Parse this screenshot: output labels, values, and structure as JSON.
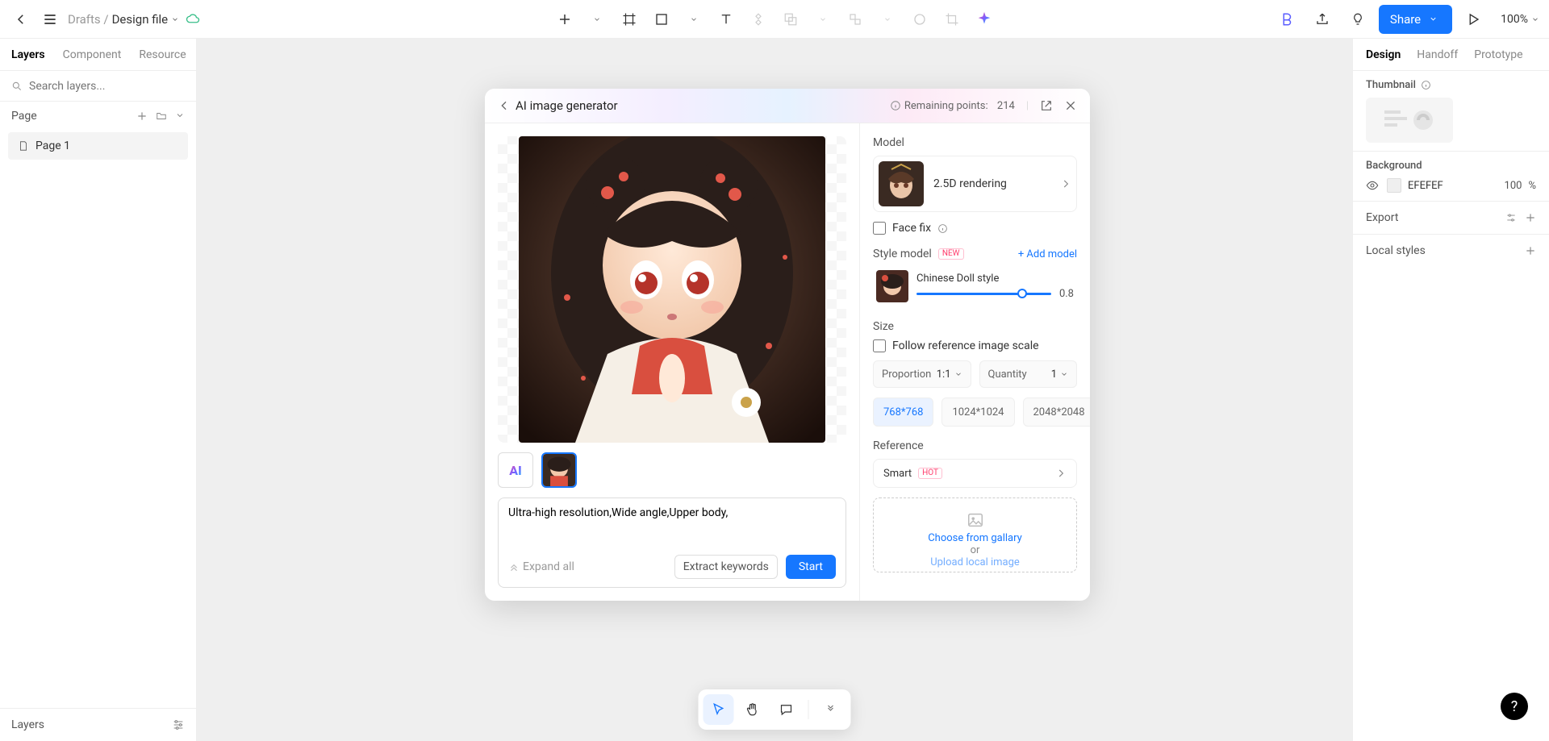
{
  "topbar": {
    "breadcrumb_prefix": "Drafts /",
    "file_name": "Design file",
    "share_label": "Share",
    "zoom": "100%"
  },
  "left_panel": {
    "tabs": [
      "Layers",
      "Component",
      "Resource"
    ],
    "search_placeholder": "Search layers...",
    "section_page": "Page",
    "pages": [
      "Page 1"
    ],
    "layers_header": "Layers"
  },
  "right_panel": {
    "tabs": [
      "Design",
      "Handoff",
      "Prototype"
    ],
    "thumbnail_label": "Thumbnail",
    "background_label": "Background",
    "bg_hex": "EFEFEF",
    "bg_opacity": "100",
    "bg_unit": "%",
    "export_label": "Export",
    "local_styles_label": "Local styles"
  },
  "modal": {
    "title": "AI image generator",
    "remaining_points_label": "Remaining points:",
    "remaining_points_value": "214",
    "prompt_value": "Ultra-high resolution,Wide angle,Upper body,",
    "expand_all": "Expand all",
    "extract_keywords": "Extract keywords",
    "start": "Start",
    "model_section": "Model",
    "model_name": "2.5D rendering",
    "face_fix": "Face fix",
    "style_model_section": "Style model",
    "new_badge": "NEW",
    "add_model": "+ Add model",
    "style_name": "Chinese Doll style",
    "style_weight": "0.8",
    "size_section": "Size",
    "follow_scale": "Follow reference image scale",
    "proportion_label": "Proportion",
    "proportion_value": "1:1",
    "quantity_label": "Quantity",
    "quantity_value": "1",
    "sizes": [
      "768*768",
      "1024*1024",
      "2048*2048"
    ],
    "reference_section": "Reference",
    "smart": "Smart",
    "hot_badge": "HOT",
    "choose_gallery": "Choose from gallary",
    "or_text": "or",
    "upload_local": "Upload local image"
  },
  "help_label": "?"
}
